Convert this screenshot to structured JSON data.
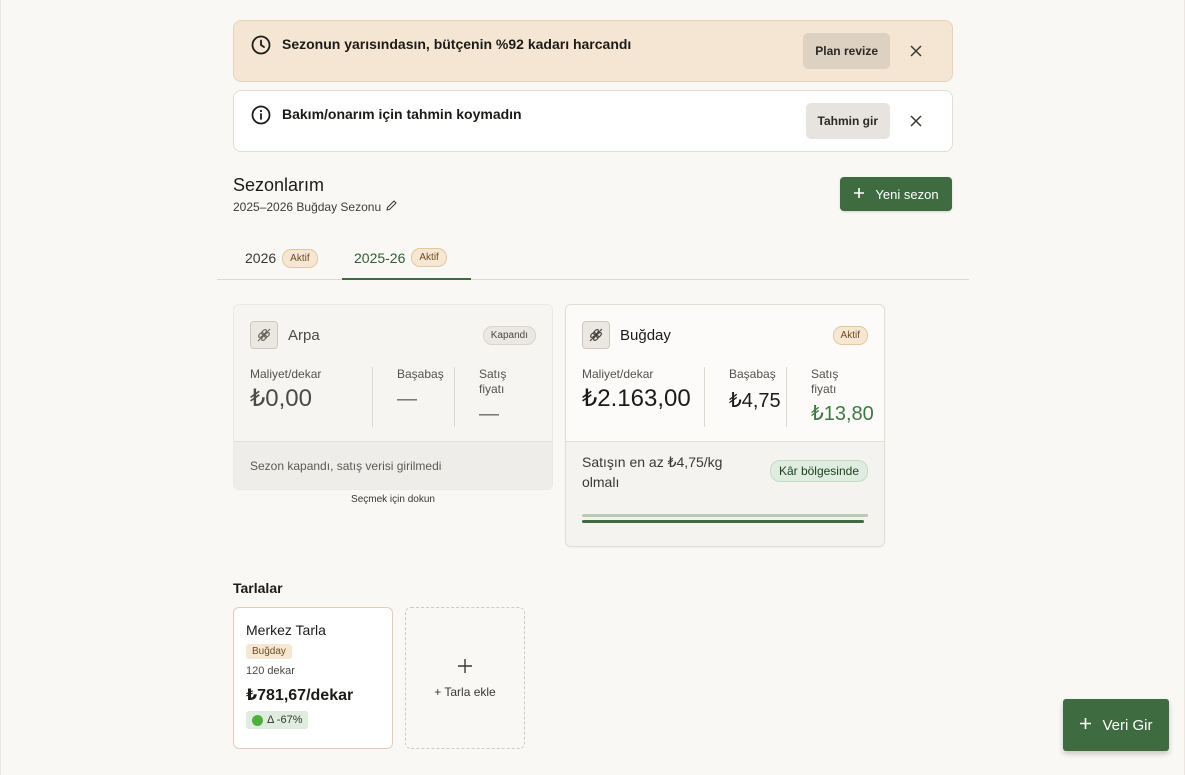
{
  "colors": {
    "primary_green": "#3e6b3f",
    "warning_bg": "#f5e6d3",
    "accent_badge_bg": "#f6e7d5",
    "positive_text": "#3e7a43"
  },
  "banners": [
    {
      "icon": "clock-icon",
      "text": "Sezonun yarısındasın, bütçenin %92 kadarı harcandı",
      "action_label": "Plan revize",
      "close_icon": "close-icon"
    },
    {
      "icon": "info-icon",
      "text": "Bakım/onarım için tahmin koymadın",
      "action_label": "Tahmin gir",
      "close_icon": "close-icon"
    }
  ],
  "seasons": {
    "title": "Sezonlarım",
    "subtitle": "2025–2026 Buğday Sezonu",
    "edit_icon": "pencil-icon",
    "new_button_label": "Yeni sezon",
    "tabs": [
      {
        "label": "2026",
        "badge": "Aktif",
        "selected": false
      },
      {
        "label": "2025-26",
        "badge": "Aktif",
        "selected": true
      }
    ]
  },
  "crop_cards": [
    {
      "name": "Arpa",
      "icon": "wheat-icon",
      "status": "Kapandı",
      "cost_label": "Maliyet/dekar",
      "cost_value": "₺0,00",
      "breakeven_label": "Başabaş",
      "breakeven_value": "—",
      "price_label": "Satış fiyatı",
      "price_value": "—",
      "footer_text": "Sezon kapandı, satış verisi girilmedi",
      "hint": "Seçmek için dokun"
    },
    {
      "name": "Buğday",
      "icon": "wheat-icon",
      "status": "Aktif",
      "cost_label": "Maliyet/dekar",
      "cost_value": "₺2.163,00",
      "breakeven_label": "Başabaş",
      "breakeven_value": "₺4,75",
      "price_label": "Satış fiyatı",
      "price_value": "₺13,80",
      "footer_text": "Satışın en az ₺4,75/kg olmalı",
      "profit_badge": "Kâr bölgesinde",
      "progress_fraction": 0.98
    }
  ],
  "fields": {
    "title": "Tarlalar",
    "items": [
      {
        "name": "Merkez Tarla",
        "crop": "Buğday",
        "area": "120 dekar",
        "cost": "₺781,67/dekar",
        "delta": "Δ -67%",
        "delta_icon": "green-dot-icon"
      }
    ],
    "add_label": "+ Tarla ekle",
    "add_icon": "plus-icon"
  },
  "fab": {
    "label": "Veri Gir",
    "icon": "plus-icon"
  }
}
